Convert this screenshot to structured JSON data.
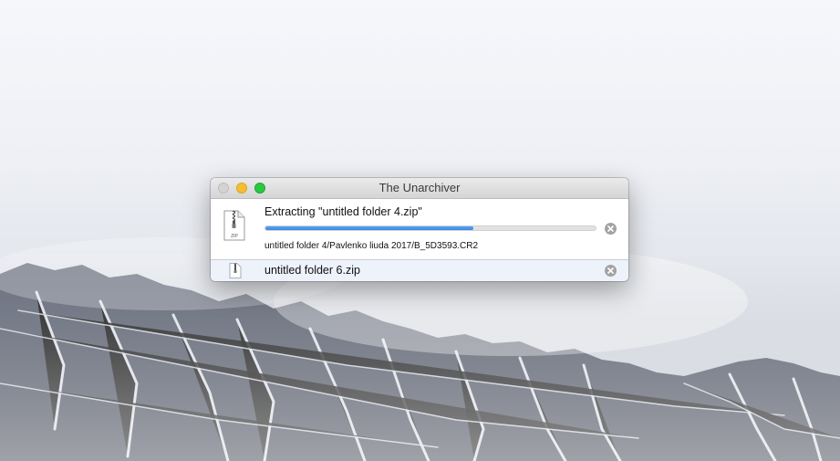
{
  "window": {
    "title": "The Unarchiver",
    "controls": [
      "close",
      "minimize",
      "zoom"
    ]
  },
  "active_task": {
    "title": "Extracting \"untitled folder 4.zip\"",
    "progress": 0.63,
    "current_file": "untitled folder 4/Pavlenko liuda 2017/B_5D3593.CR2",
    "icon": "zip-file-icon",
    "icon_label": "ZIP",
    "stop_icon": "stop-x-icon"
  },
  "queued_task": {
    "name": "untitled folder 6.zip",
    "icon": "zip-file-icon",
    "stop_icon": "stop-x-icon"
  },
  "colors": {
    "progress_fill": "#3a86e6",
    "queued_row_bg": "#edf2fb",
    "minimize": "#f5bf2f",
    "zoom": "#2ac840"
  }
}
